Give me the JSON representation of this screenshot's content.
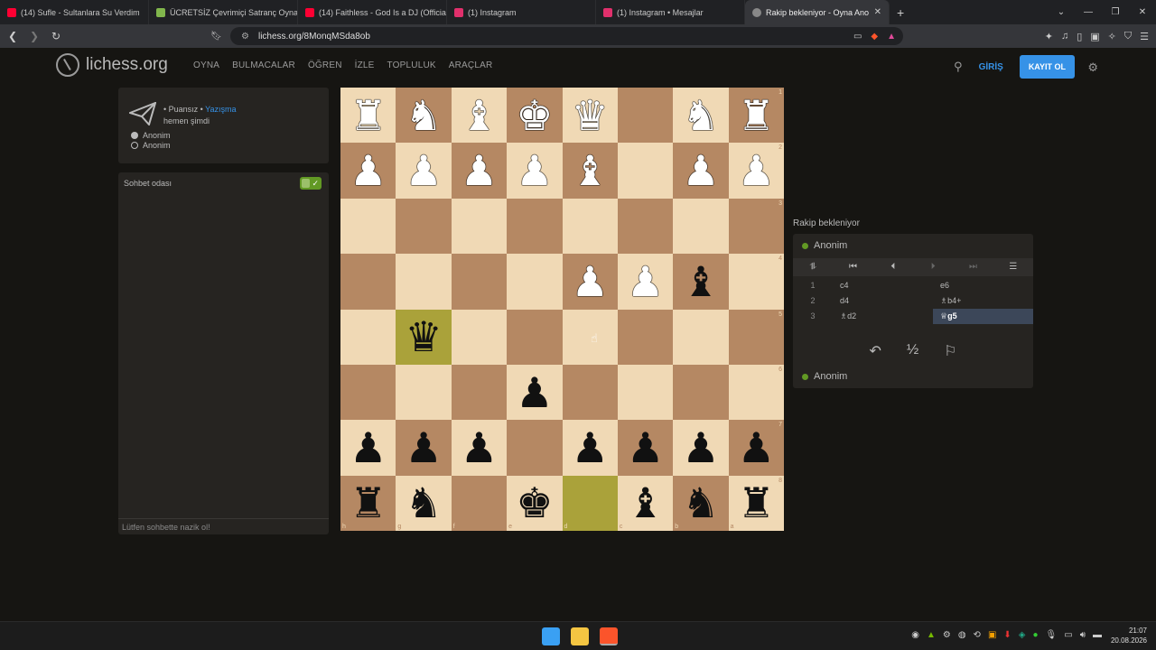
{
  "browser": {
    "tabs": [
      {
        "title": "(14) Sufle - Sultanlara Su Verdim",
        "favicon_color": "#ff0033"
      },
      {
        "title": "ÜCRETSİZ Çevrimiçi Satranç Oynayın",
        "favicon_color": "#81b64c"
      },
      {
        "title": "(14) Faithless - God Is a DJ (Official V",
        "favicon_color": "#ff0033"
      },
      {
        "title": "(1) Instagram",
        "favicon_color": "#e1306c"
      },
      {
        "title": "(1) Instagram • Mesajlar",
        "favicon_color": "#e1306c"
      },
      {
        "title": "Rakip bekleniyor - Oyna Anon",
        "favicon_color": "#888888",
        "active": true
      }
    ],
    "url": "lichess.org/8MonqMSda8ob"
  },
  "site": {
    "logo_text": "lichess.org",
    "menu": [
      "OYNA",
      "BULMACALAR",
      "ÖĞREN",
      "İZLE",
      "TOPLULUK",
      "ARAÇLAR"
    ],
    "login_label": "GİRİŞ",
    "signup_label": "KAYIT OL"
  },
  "game_info": {
    "type_prefix": "• Puansız •",
    "type_link": "Yazışma",
    "time": "hemen şimdi",
    "white_player": "Anonim",
    "black_player": "Anonim"
  },
  "chat": {
    "title": "Sohbet odası",
    "placeholder": "Lütfen sohbette nazik ol!"
  },
  "board": {
    "orientation": "white-top",
    "ranks": [
      "1",
      "2",
      "3",
      "4",
      "5",
      "6",
      "7",
      "8"
    ],
    "files": [
      "h",
      "g",
      "f",
      "e",
      "d",
      "c",
      "b",
      "a"
    ],
    "squares": [
      [
        "wR",
        "wN",
        "wB",
        "wK",
        "wQ",
        "",
        "wN",
        "wR"
      ],
      [
        "wP",
        "wP",
        "wP",
        "wP",
        "wB",
        "",
        "wP",
        "wP"
      ],
      [
        "",
        "",
        "",
        "",
        "",
        "",
        "",
        ""
      ],
      [
        "",
        "",
        "",
        "",
        "wP",
        "wP",
        "bB",
        ""
      ],
      [
        "",
        "bQ",
        "",
        "",
        "",
        "",
        "",
        ""
      ],
      [
        "",
        "",
        "",
        "bP",
        "",
        "",
        "",
        ""
      ],
      [
        "bP",
        "bP",
        "bP",
        "",
        "bP",
        "bP",
        "bP",
        "bP"
      ],
      [
        "bR",
        "bN",
        "",
        "bK",
        "",
        "bB",
        "bN",
        "bR"
      ]
    ],
    "highlight": [
      [
        4,
        1
      ],
      [
        7,
        4
      ]
    ]
  },
  "right_panel": {
    "status": "Rakip bekleniyor",
    "opponent": "Anonim",
    "player": "Anonim",
    "moves": [
      {
        "n": "1",
        "white": "c4",
        "black": "e6"
      },
      {
        "n": "2",
        "white": "d4",
        "black": "♗b4+"
      },
      {
        "n": "3",
        "white": "♗d2",
        "black": "♕g5"
      }
    ],
    "draw_label": "½"
  },
  "taskbar": {
    "time": "21:07",
    "date": "20.08.2026"
  }
}
